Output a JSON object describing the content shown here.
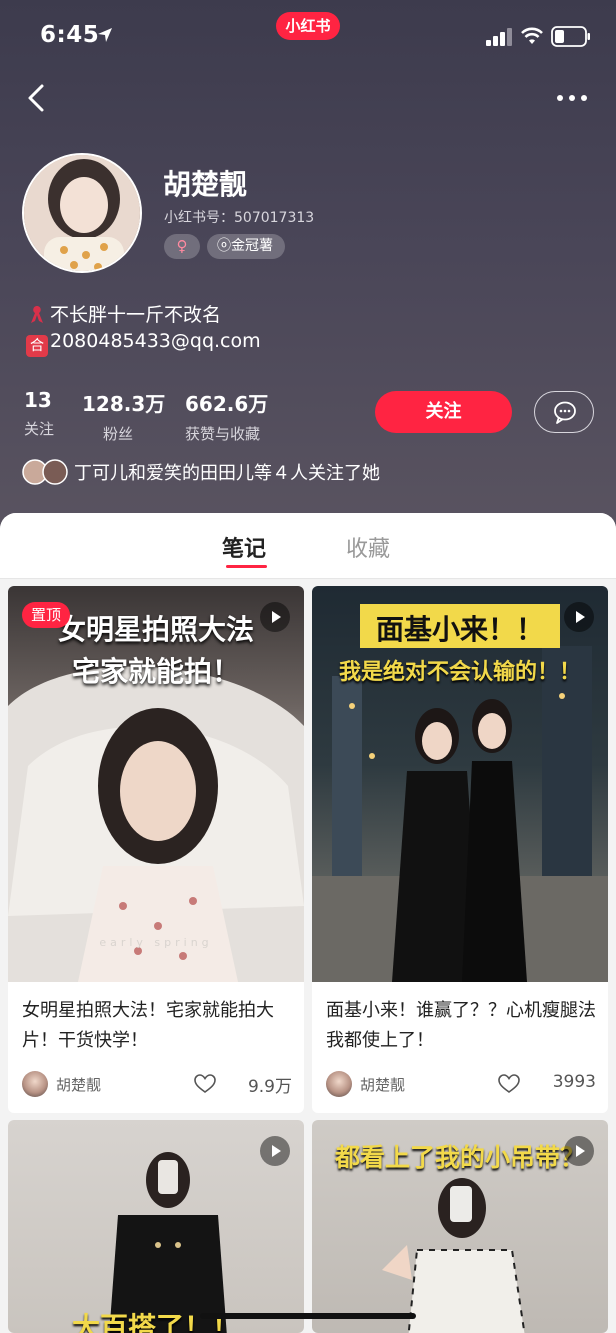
{
  "status_bar": {
    "time": "6:45"
  },
  "app_badge": "小红书",
  "profile": {
    "name": "胡楚靓",
    "red_id": "小红书号：507017313",
    "gender_tag": "♀",
    "brand_tag": "金冠薯",
    "bio_line1": "不长胖十一斤不改名",
    "bio_line2": "2080485433@qq.com",
    "bio_line2_icon": "合",
    "stats": [
      {
        "value": "13",
        "label": "关注"
      },
      {
        "value": "128.3万",
        "label": "粉丝"
      },
      {
        "value": "662.6万",
        "label": "获赞与收藏"
      }
    ],
    "follow_label": "关注",
    "mutual_text": "丁可儿和爱笑的田田儿等４人关注了她"
  },
  "tabs": [
    {
      "label": "笔记",
      "active": true
    },
    {
      "label": "收藏",
      "active": false
    }
  ],
  "notes": [
    {
      "pin_label": "置顶",
      "overlay_line1": "女明星拍照大法",
      "overlay_line2": "宅家就能拍！",
      "watermark": "early spring",
      "title": "女明星拍照大法！宅家就能拍大片！干货快学！",
      "author": "胡楚靓",
      "likes": "9.9万"
    },
    {
      "overlay_line1": "面基小来！！",
      "overlay_line2": "我是绝对不会认输的！！",
      "title": "面基小来！谁赢了？？心机瘦腿法我都使上了！",
      "author": "胡楚靓",
      "likes": "3993"
    },
    {
      "overlay_line1": "大百搭了！！",
      "video": true
    },
    {
      "overlay_line1": "都看上了我的小吊带？",
      "video": true
    }
  ],
  "icons": {
    "back": "chevron-left-icon",
    "more": "more-dots-icon",
    "message": "chat-bubble-icon",
    "like": "heart-icon",
    "video": "play-icon"
  },
  "colors": {
    "accent": "#ff2442",
    "header_bg": "#4a4658"
  }
}
